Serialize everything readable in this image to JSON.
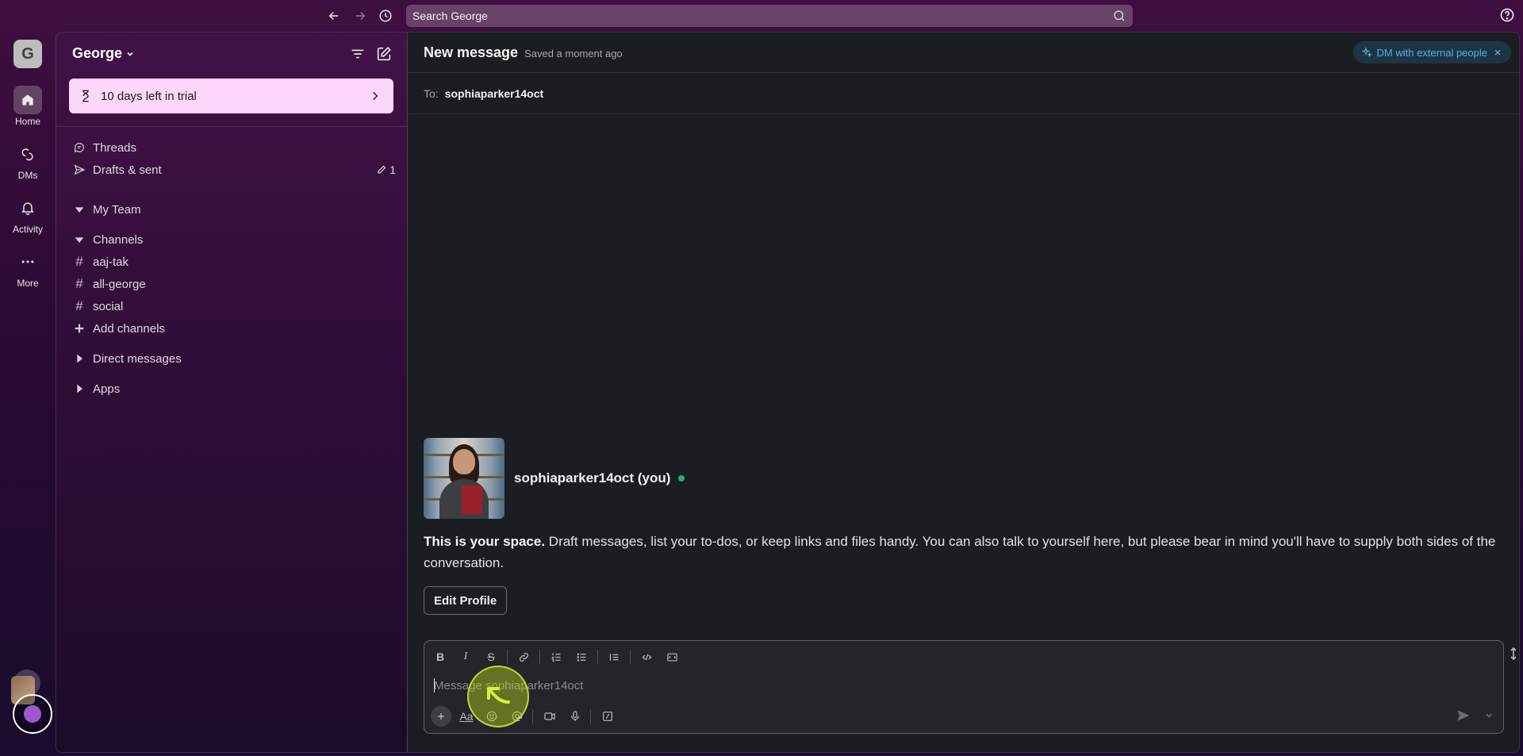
{
  "topbar": {
    "search_placeholder": "Search George"
  },
  "rail": {
    "workspace_initial": "G",
    "items": [
      {
        "label": "Home"
      },
      {
        "label": "DMs"
      },
      {
        "label": "Activity"
      },
      {
        "label": "More"
      }
    ],
    "add_label": "+"
  },
  "sidebar": {
    "workspace_name": "George",
    "trial_text": "10 days left in trial",
    "nav": [
      {
        "label": "Threads"
      },
      {
        "label": "Drafts & sent",
        "badge": "1"
      }
    ],
    "sections": {
      "my_team": "My Team",
      "channels": "Channels",
      "direct_messages": "Direct messages",
      "apps": "Apps"
    },
    "channels": [
      {
        "name": "aaj-tak"
      },
      {
        "name": "all-george"
      },
      {
        "name": "social"
      }
    ],
    "add_channels": "Add channels"
  },
  "main": {
    "title": "New message",
    "saved_status": "Saved a moment ago",
    "dm_external": "DM with external people",
    "to_label": "To:",
    "to_value": "sophiaparker14oct",
    "profile_name": "sophiaparker14oct (you)",
    "intro_bold": "This is your space.",
    "intro_text": " Draft messages, list your to-dos, or keep links and files handy. You can also talk to yourself here, but please bear in mind you'll have to supply both sides of the conversation.",
    "edit_profile": "Edit Profile",
    "composer": {
      "placeholder": "Message sophiaparker14oct",
      "format_label": "Aa"
    }
  },
  "colors": {
    "sidebar_purple": "#3f0e40",
    "main_bg": "#1a1d21",
    "trial_bg": "#fcd6fb",
    "online_green": "#2bac76",
    "external_blue": "#4fb1e6"
  }
}
